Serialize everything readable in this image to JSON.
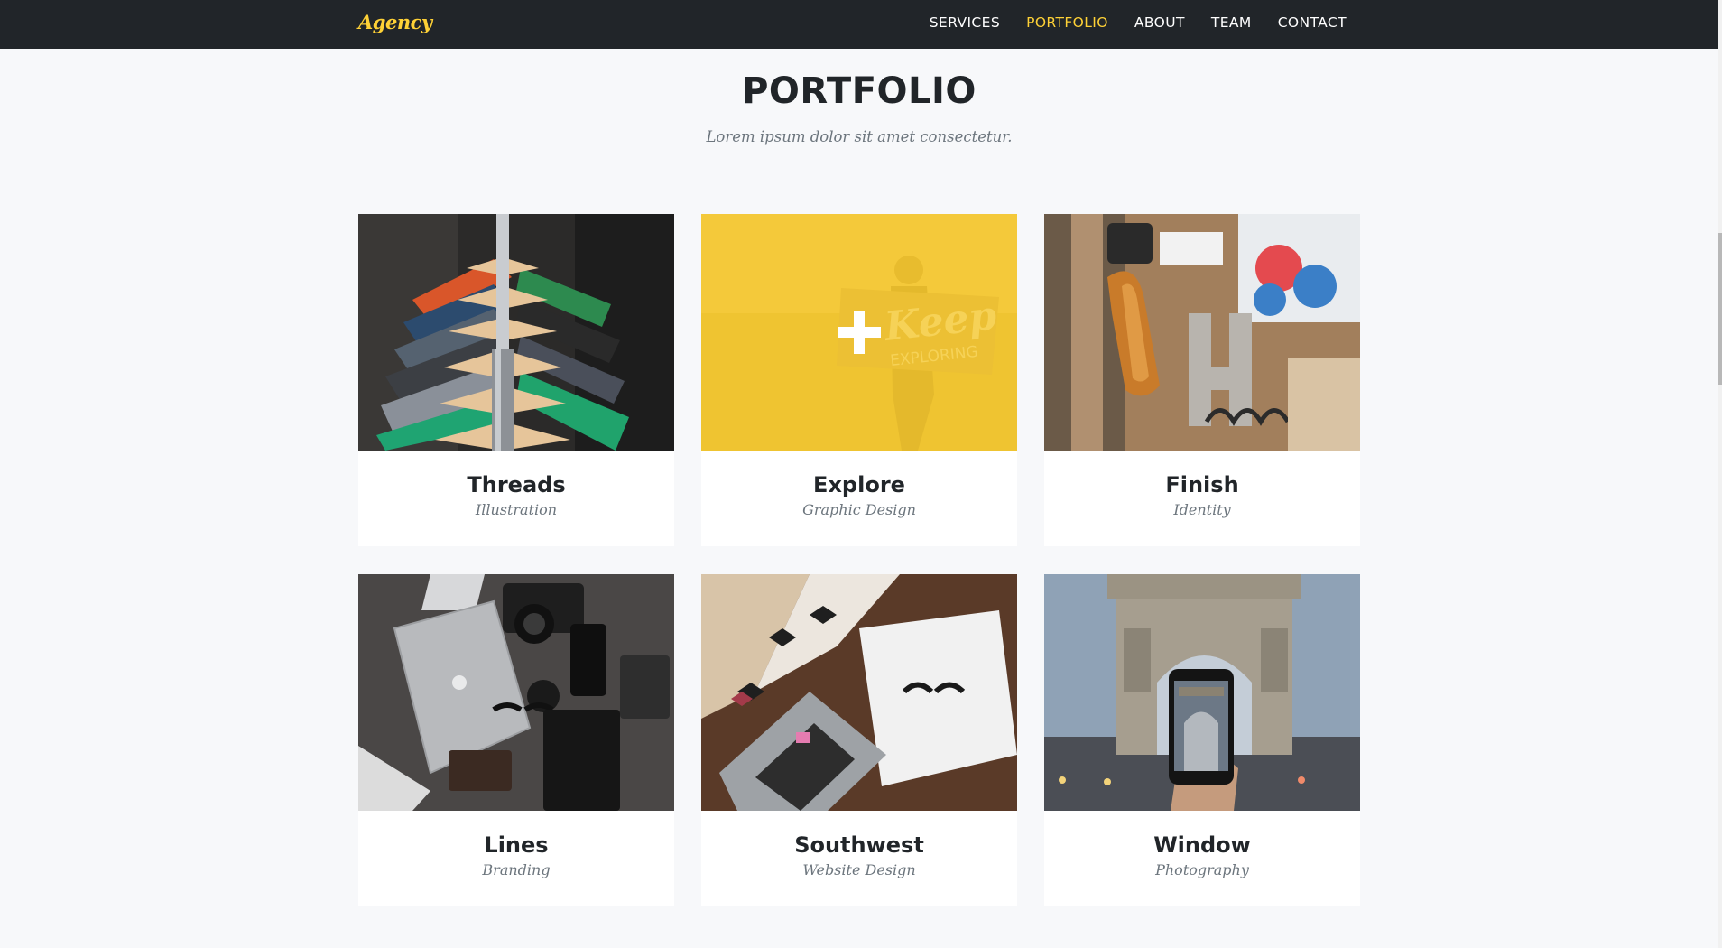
{
  "navbar": {
    "brand": "Agency",
    "links": [
      {
        "label": "SERVICES",
        "active": false
      },
      {
        "label": "PORTFOLIO",
        "active": true
      },
      {
        "label": "ABOUT",
        "active": false
      },
      {
        "label": "TEAM",
        "active": false
      },
      {
        "label": "CONTACT",
        "active": false
      }
    ]
  },
  "section": {
    "heading": "PORTFOLIO",
    "subheading": "Lorem ipsum dolor sit amet consectetur."
  },
  "portfolio": {
    "items": [
      {
        "title": "Threads",
        "category": "Illustration",
        "image": "clothes-hangers-photo",
        "hovered": false
      },
      {
        "title": "Explore",
        "category": "Graphic Design",
        "image": "keep-exploring-photo",
        "hovered": true
      },
      {
        "title": "Finish",
        "category": "Identity",
        "image": "design-tools-photo",
        "hovered": false
      },
      {
        "title": "Lines",
        "category": "Branding",
        "image": "laptop-camera-flatlay-photo",
        "hovered": false
      },
      {
        "title": "Southwest",
        "category": "Website Design",
        "image": "desk-laptop-glasses-photo",
        "hovered": false
      },
      {
        "title": "Window",
        "category": "Photography",
        "image": "arc-de-triomphe-phone-photo",
        "hovered": false
      }
    ]
  },
  "colors": {
    "navbar_bg": "#212529",
    "accent": "#fed136",
    "page_bg": "#f7f8fa",
    "text_dark": "#212529",
    "text_muted": "#6c757d"
  }
}
